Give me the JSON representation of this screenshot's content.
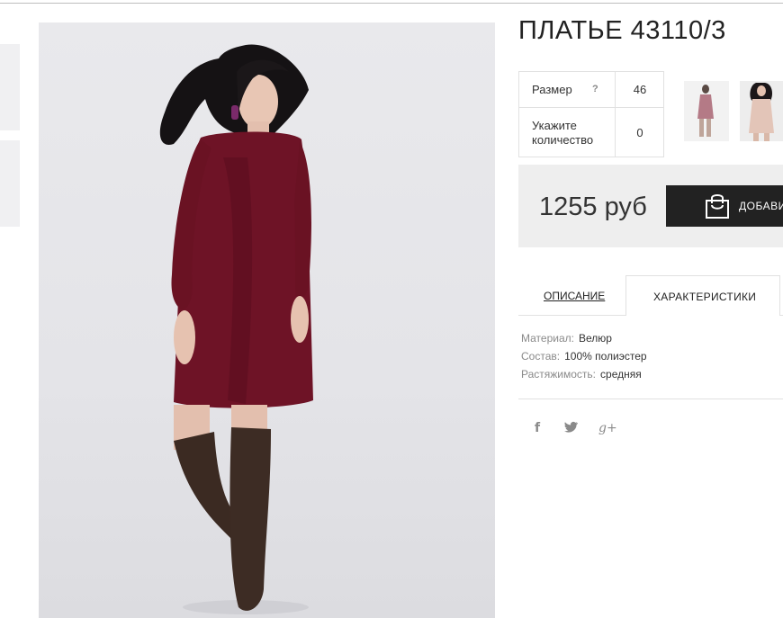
{
  "product": {
    "title": "ПЛАТЬЕ 43110/3",
    "image_alt": "model-in-burgundy-velour-dress-and-brown-boots"
  },
  "options": {
    "size_label": "Размер",
    "size_help": "?",
    "size_value": "46",
    "qty_label": "Укажите количество",
    "qty_value": "0"
  },
  "thumbnails": [
    {
      "icon": "dress-thumbnail-pink"
    },
    {
      "icon": "dress-thumbnail-beige"
    }
  ],
  "purchase": {
    "price": "1255 руб",
    "add_label": "ДОБАВИТЬ",
    "bag_icon": "shopping-bag-icon"
  },
  "tabs": {
    "description": "ОПИСАНИЕ",
    "specs": "ХАРАКТЕРИСТИКИ",
    "active": "specs"
  },
  "specs": [
    {
      "key": "Материал:",
      "value": "Велюр"
    },
    {
      "key": "Состав:",
      "value": "100% полиэстер"
    },
    {
      "key": "Растяжимость:",
      "value": "средняя"
    }
  ],
  "social": {
    "facebook": "f",
    "twitter": "🐦",
    "googleplus": "g+"
  },
  "colors": {
    "dress": "#6e1326",
    "boots": "#3b2a22",
    "button": "#222222",
    "price_box": "#eeeeee"
  }
}
